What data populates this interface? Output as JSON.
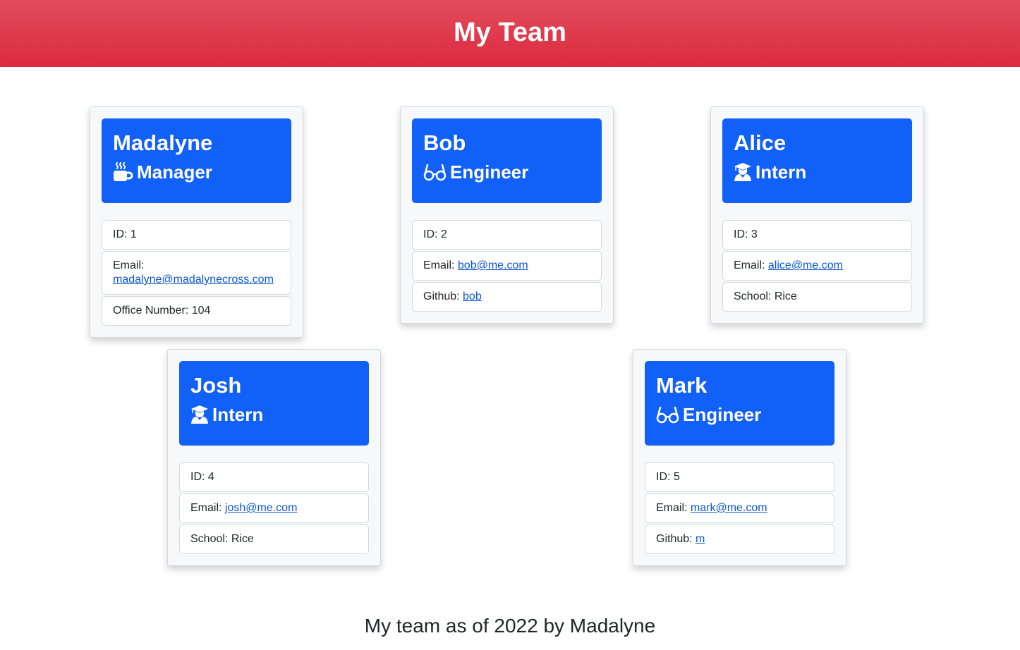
{
  "header": {
    "title": "My Team"
  },
  "cards": [
    {
      "name": "Madalyne",
      "role": "Manager",
      "icon": "mug-icon",
      "id_label": "ID: 1",
      "email_label": "Email: ",
      "email": "madalyne@madalynecross.com",
      "extra_label": "Office Number: 104",
      "extra_link": ""
    },
    {
      "name": "Bob",
      "role": "Engineer",
      "icon": "glasses-icon",
      "id_label": "ID: 2",
      "email_label": "Email: ",
      "email": "bob@me.com",
      "extra_label": "Github: ",
      "extra_link": "bob"
    },
    {
      "name": "Alice",
      "role": "Intern",
      "icon": "graduate-icon",
      "id_label": "ID: 3",
      "email_label": "Email: ",
      "email": "alice@me.com",
      "extra_label": "School: Rice",
      "extra_link": ""
    },
    {
      "name": "Josh",
      "role": "Intern",
      "icon": "graduate-icon",
      "id_label": "ID: 4",
      "email_label": "Email: ",
      "email": "josh@me.com",
      "extra_label": "School: Rice",
      "extra_link": ""
    },
    {
      "name": "Mark",
      "role": "Engineer",
      "icon": "glasses-icon",
      "id_label": "ID: 5",
      "email_label": "Email: ",
      "email": "mark@me.com",
      "extra_label": "Github: ",
      "extra_link": "m"
    }
  ],
  "footer": {
    "text": "My team as of 2022 by Madalyne"
  },
  "colors": {
    "header_bg": "#dc3545",
    "card_head_bg": "#1160f7",
    "link": "#0b57d0"
  }
}
